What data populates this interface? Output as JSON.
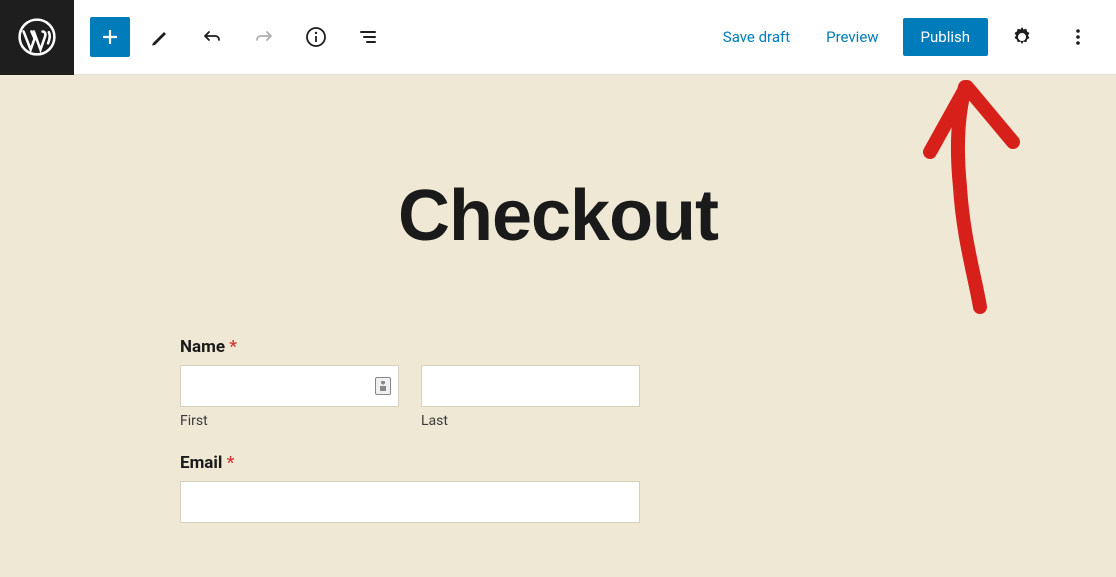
{
  "toolbar": {
    "save_draft": "Save draft",
    "preview": "Preview",
    "publish": "Publish"
  },
  "page": {
    "title": "Checkout",
    "form": {
      "name": {
        "label": "Name",
        "first_sub": "First",
        "last_sub": "Last"
      },
      "email": {
        "label": "Email"
      }
    }
  },
  "required_mark": "*"
}
